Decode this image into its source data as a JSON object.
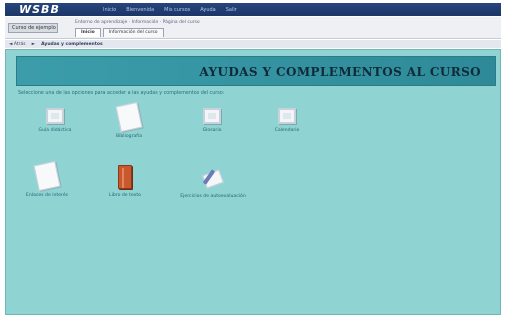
{
  "header": {
    "logo": "WSBB",
    "menu": [
      "Inicio",
      "Bienvenida",
      "Mis cursos",
      "Ayuda",
      "Salir"
    ]
  },
  "toolbar": {
    "course_select": "Curso de ejemplo",
    "path_text": "Entorno de aprendizaje · Información · Página del curso",
    "tabs": [
      "Inicio",
      "Información del curso"
    ],
    "active_tab": "Inicio",
    "nav_back": "◄ Atrás",
    "nav_forward": "►",
    "breadcrumb": "Ayudas y complementos"
  },
  "content": {
    "title": "AYUDAS Y COMPLEMENTOS AL CURSO",
    "intro": "Seleccione una de las opciones para acceder a las ayudas y complementos del curso:",
    "items": [
      {
        "icon": "window-icon",
        "label": "Guía didáctica"
      },
      {
        "icon": "document-icon",
        "label": "Bibliografía"
      },
      {
        "icon": "window-icon",
        "label": "Glosario"
      },
      {
        "icon": "window-icon",
        "label": "Calendario"
      },
      {
        "icon": "document-icon",
        "label": "Enlaces de interés"
      },
      {
        "icon": "book-icon",
        "label": "Libro de texto"
      },
      {
        "icon": "pen-icon",
        "label": "Ejercicios de autoevaluación"
      }
    ]
  },
  "colors": {
    "content_bg": "#8fd3d3",
    "banner_bg": "#3c9daa",
    "header_bg": "#27467e"
  }
}
